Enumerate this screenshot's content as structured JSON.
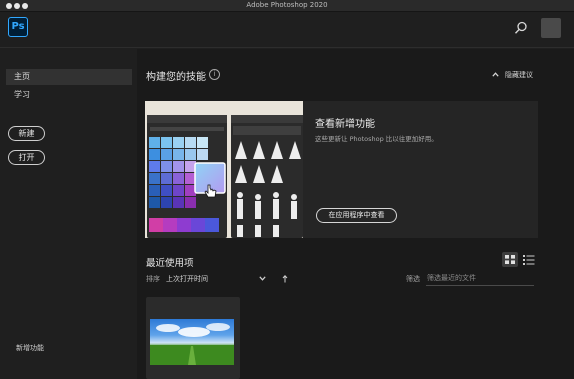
{
  "window": {
    "title": "Adobe Photoshop 2020"
  },
  "appbar": {
    "logo_text": "Ps",
    "search_icon": "search-icon",
    "avatar_icon": "avatar"
  },
  "sidebar": {
    "items": [
      {
        "label": "主页",
        "active": true
      },
      {
        "label": "学习",
        "active": false
      }
    ],
    "new_button": "新建",
    "open_button": "打开",
    "whats_new": "新增功能"
  },
  "skills": {
    "title": "构建您的技能",
    "hide_link": "隐藏建议",
    "card": {
      "title": "查看新增功能",
      "description": "这些更新让 Photoshop 比以往更加好用。",
      "button": "在应用程序中查看"
    }
  },
  "recent": {
    "title": "最近使用项",
    "sort_label": "排序",
    "sort_value": "上次打开时间",
    "filter_label": "筛选",
    "filter_placeholder": "筛选最近的文件"
  },
  "colors": {
    "accent": "#31a8ff",
    "background": "#1a1a1a",
    "sidebar": "#1f1f1f"
  }
}
